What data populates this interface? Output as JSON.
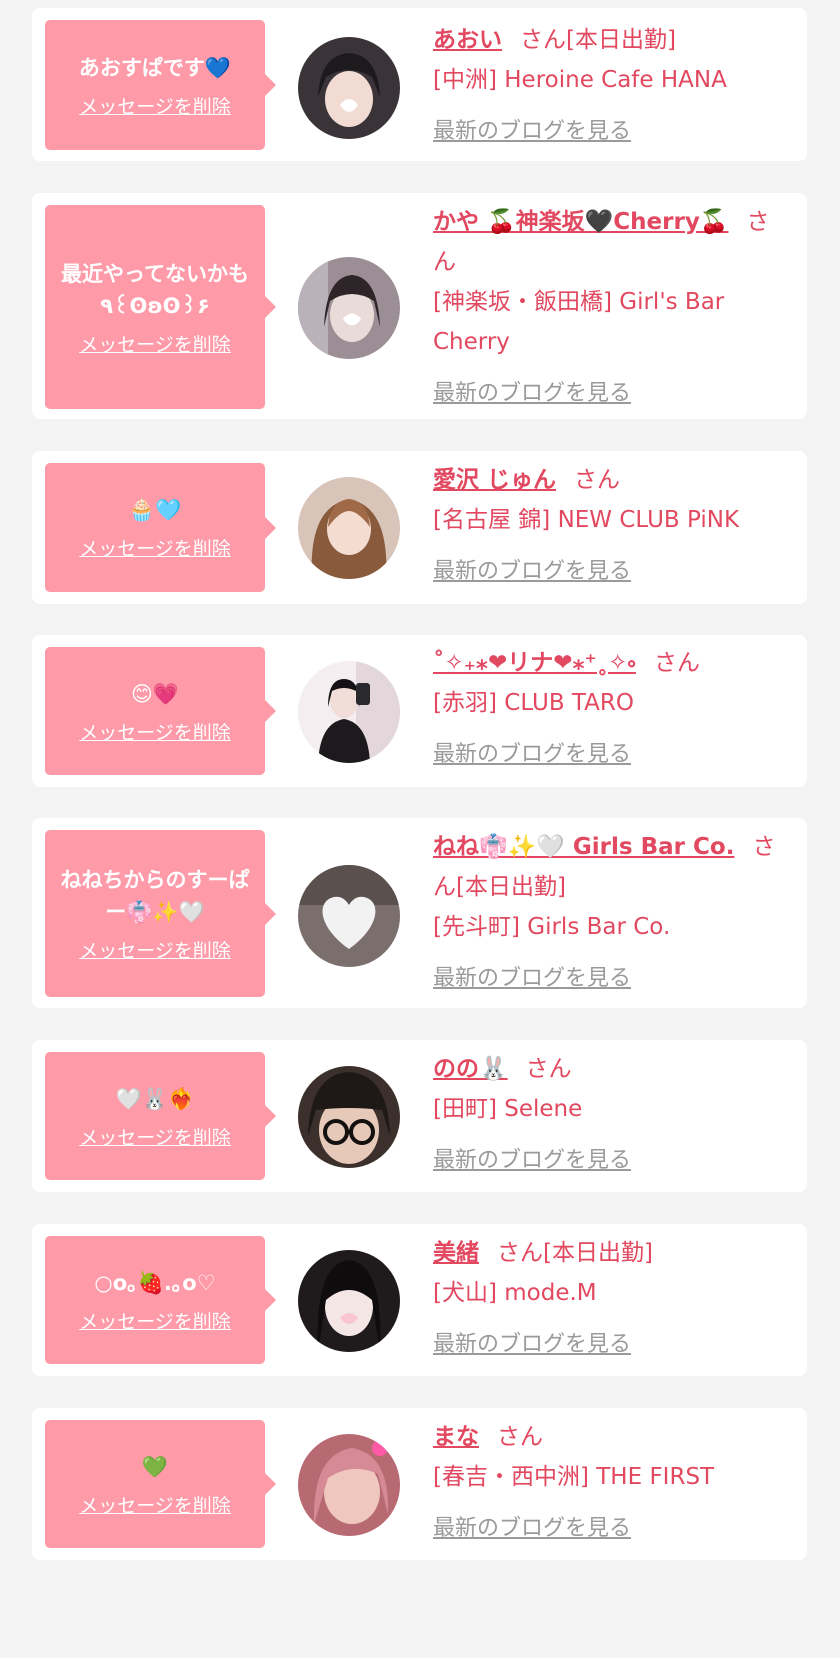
{
  "cards": [
    {
      "message": "あおすぱです💙",
      "delete_label": "メッセージを削除",
      "name": "あおい",
      "suffix": "さん[本日出勤]",
      "shop": "[中洲] Heroine Cafe HANA",
      "blog_label": "最新のブログを見る"
    },
    {
      "message": "最近やってないかも٩꒰ʘʚʘ꒱۶",
      "delete_label": "メッセージを削除",
      "name": "かや 🍒神楽坂🖤Cherry🍒",
      "suffix": "さん",
      "shop": "[神楽坂・飯田橋] Girl's Bar Cherry",
      "blog_label": "最新のブログを見る"
    },
    {
      "message": "🧁🩵",
      "delete_label": "メッセージを削除",
      "name": "愛沢 じゅん",
      "suffix": "さん",
      "shop": "[名古屋 錦] NEW CLUB PiNK",
      "blog_label": "最新のブログを見る"
    },
    {
      "message": "😊💗",
      "delete_label": "メッセージを削除",
      "name": "˚✧₊⁎❤︎リナ❤︎⁎⁺˳✧༚",
      "suffix": "さん",
      "shop": "[赤羽] CLUB TARO",
      "blog_label": "最新のブログを見る"
    },
    {
      "message": "ねねちからのすーぱー👘✨🤍",
      "delete_label": "メッセージを削除",
      "name": "ねね👘✨🤍 Girls Bar Co.",
      "suffix": "さん[本日出勤]",
      "shop": "[先斗町] Girls Bar Co.",
      "blog_label": "最新のブログを見る"
    },
    {
      "message": "🤍🐰❤️‍🔥",
      "delete_label": "メッセージを削除",
      "name": "のの🐰",
      "suffix": "さん",
      "shop": "[田町] Selene",
      "blog_label": "最新のブログを見る"
    },
    {
      "message": "○o｡🍓.｡o♡",
      "delete_label": "メッセージを削除",
      "name": "美緒",
      "suffix": "さん[本日出勤]",
      "shop": "[犬山] mode.M",
      "blog_label": "最新のブログを見る"
    },
    {
      "message": "💚",
      "delete_label": "メッセージを削除",
      "name": "まな",
      "suffix": "さん",
      "shop": "[春吉・西中洲] THE FIRST",
      "blog_label": "最新のブログを見る"
    }
  ],
  "avatars": [
    {
      "icon": "avatar-photo",
      "bg": "#3a3438"
    },
    {
      "icon": "avatar-photo",
      "bg": "#9b8f95"
    },
    {
      "icon": "avatar-photo",
      "bg": "#c9a58c"
    },
    {
      "icon": "avatar-photo",
      "bg": "#e9e1e3"
    },
    {
      "icon": "avatar-photo",
      "bg": "#7a6f6c"
    },
    {
      "icon": "avatar-photo",
      "bg": "#3b302c"
    },
    {
      "icon": "avatar-photo",
      "bg": "#1f1b1d"
    },
    {
      "icon": "avatar-photo",
      "bg": "#b86a72"
    }
  ]
}
